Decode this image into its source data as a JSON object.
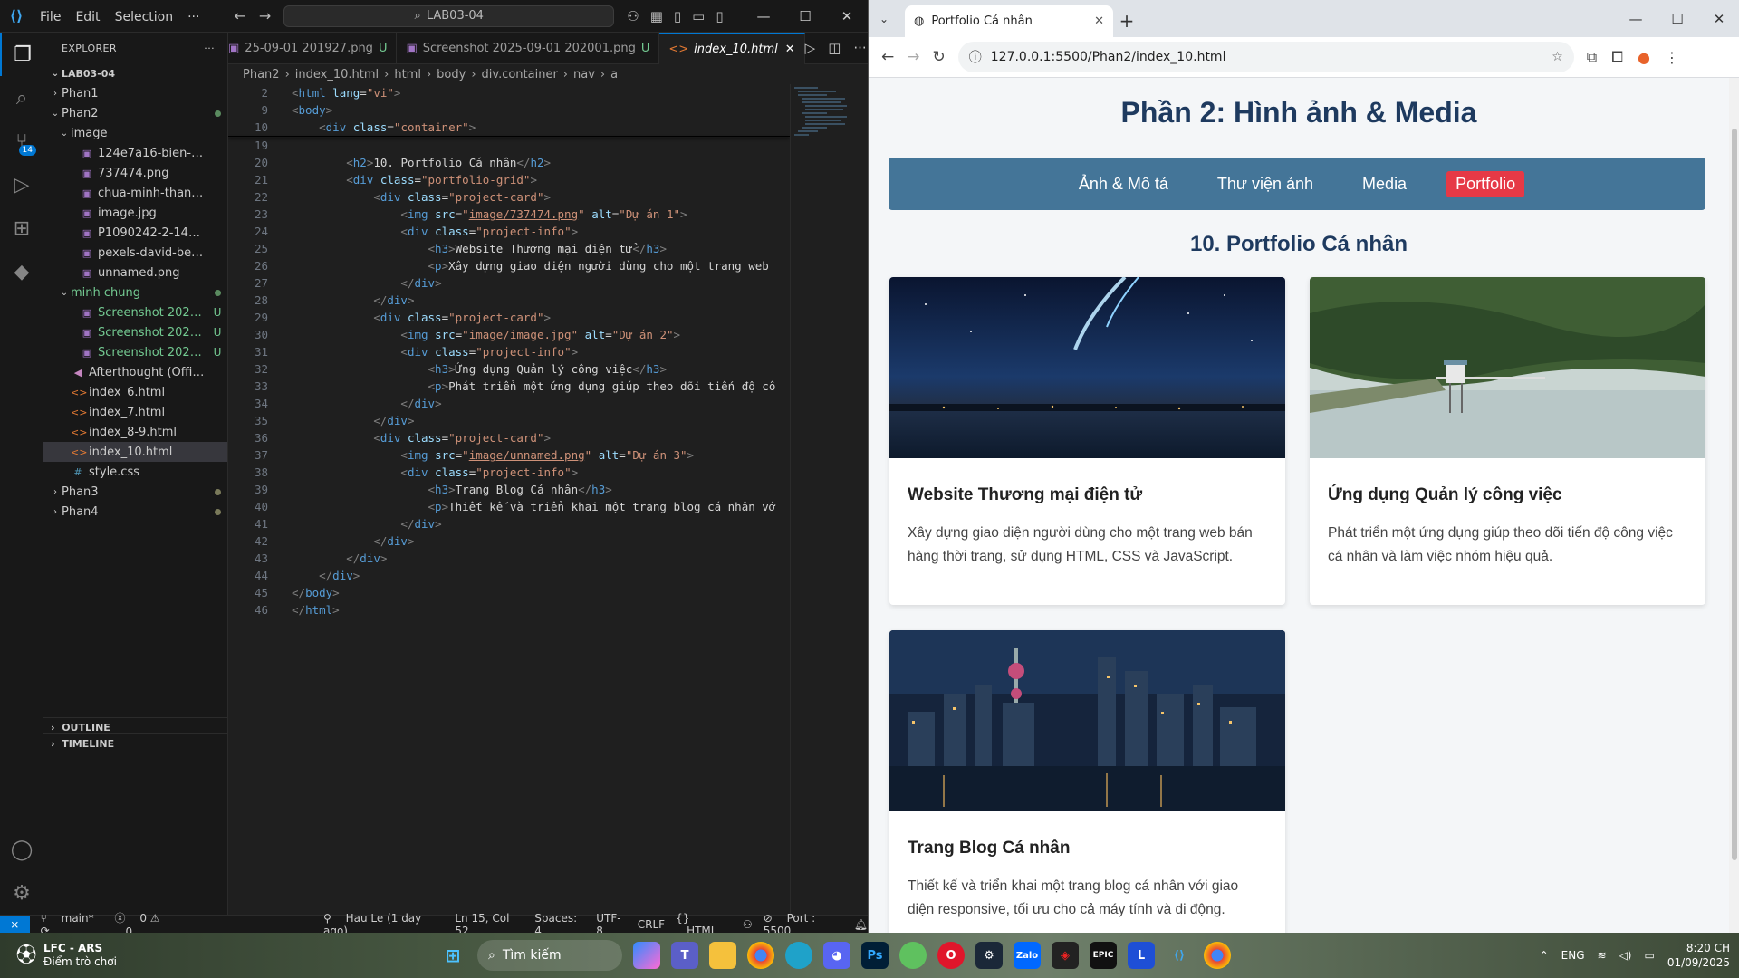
{
  "vscode": {
    "menu": [
      "File",
      "Edit",
      "Selection",
      "···"
    ],
    "command_center": "LAB03-04",
    "explorer_title": "EXPLORER",
    "explorer_more": "···",
    "root": "LAB03-04",
    "tree": [
      {
        "indent": 0,
        "arrow": "›",
        "icon": "",
        "name": "Phan1",
        "status": "",
        "color": "#ccc"
      },
      {
        "indent": 0,
        "arrow": "⌄",
        "icon": "",
        "name": "Phan2",
        "status": "dot",
        "color": "#ccc"
      },
      {
        "indent": 1,
        "arrow": "⌄",
        "icon": "",
        "name": "image",
        "status": "",
        "color": "#ccc"
      },
      {
        "indent": 2,
        "arrow": "",
        "icon": "▣",
        "name": "124e7a16-bien-ho-pleik...",
        "status": "",
        "color": "#ccc"
      },
      {
        "indent": 2,
        "arrow": "",
        "icon": "▣",
        "name": "737474.png",
        "status": "",
        "color": "#ccc"
      },
      {
        "indent": 2,
        "arrow": "",
        "icon": "▣",
        "name": "chua-minh-thanh-pleiku...",
        "status": "",
        "color": "#ccc"
      },
      {
        "indent": 2,
        "arrow": "",
        "icon": "▣",
        "name": "image.jpg",
        "status": "",
        "color": "#ccc"
      },
      {
        "indent": 2,
        "arrow": "",
        "icon": "▣",
        "name": "P1090242-2-1400x788.jpg",
        "status": "",
        "color": "#ccc"
      },
      {
        "indent": 2,
        "arrow": "",
        "icon": "▣",
        "name": "pexels-david-besh-8847...",
        "status": "",
        "color": "#ccc"
      },
      {
        "indent": 2,
        "arrow": "",
        "icon": "▣",
        "name": "unnamed.png",
        "status": "",
        "color": "#ccc"
      },
      {
        "indent": 1,
        "arrow": "⌄",
        "icon": "",
        "name": "minh chung",
        "status": "dot",
        "color": "#73c991"
      },
      {
        "indent": 2,
        "arrow": "",
        "icon": "▣",
        "name": "Screenshot 2025-09...",
        "status": "U",
        "color": "#73c991"
      },
      {
        "indent": 2,
        "arrow": "",
        "icon": "▣",
        "name": "Screenshot 2025-09...",
        "status": "U",
        "color": "#73c991"
      },
      {
        "indent": 2,
        "arrow": "",
        "icon": "▣",
        "name": "Screenshot 2025-09...",
        "status": "U",
        "color": "#73c991"
      },
      {
        "indent": 1,
        "arrow": "",
        "icon": "◀",
        "name": "Afterthought (Official Audi...",
        "status": "",
        "color": "#ccc"
      },
      {
        "indent": 1,
        "arrow": "",
        "icon": "<>",
        "name": "index_6.html",
        "status": "",
        "color": "#ccc"
      },
      {
        "indent": 1,
        "arrow": "",
        "icon": "<>",
        "name": "index_7.html",
        "status": "",
        "color": "#ccc"
      },
      {
        "indent": 1,
        "arrow": "",
        "icon": "<>",
        "name": "index_8-9.html",
        "status": "",
        "color": "#ccc"
      },
      {
        "indent": 1,
        "arrow": "",
        "icon": "<>",
        "name": "index_10.html",
        "status": "",
        "color": "#ccc",
        "selected": true
      },
      {
        "indent": 1,
        "arrow": "",
        "icon": "#",
        "name": "style.css",
        "status": "",
        "color": "#ccc"
      },
      {
        "indent": 0,
        "arrow": "›",
        "icon": "",
        "name": "Phan3",
        "status": "dotg",
        "color": "#ccc"
      },
      {
        "indent": 0,
        "arrow": "›",
        "icon": "",
        "name": "Phan4",
        "status": "dotg",
        "color": "#ccc"
      }
    ],
    "outline": "OUTLINE",
    "timeline": "TIMELINE",
    "tabs": [
      {
        "label": "25-09-01 201927.png",
        "u": "U",
        "active": false
      },
      {
        "label": "Screenshot 2025-09-01 202001.png",
        "u": "U",
        "active": false
      },
      {
        "label": "index_10.html",
        "u": "",
        "active": true
      }
    ],
    "breadcrumb": [
      "Phan2",
      "index_10.html",
      "html",
      "body",
      "div.container",
      "nav",
      "a"
    ],
    "code": [
      {
        "n": "2",
        "h": "<span class='br'>&lt;</span><span class='tg'>html</span> <span class='at'>lang</span><span class='tx'>=</span><span class='sv'>\"vi\"</span><span class='br'>&gt;</span>",
        "stick": true
      },
      {
        "n": "9",
        "h": "<span class='br'>&lt;</span><span class='tg'>body</span><span class='br'>&gt;</span>",
        "stick": true
      },
      {
        "n": "10",
        "h": "    <span class='br'>&lt;</span><span class='tg'>div</span> <span class='at'>class</span><span class='tx'>=</span><span class='sv'>\"container\"</span><span class='br'>&gt;</span>",
        "stick": true
      },
      {
        "n": "19",
        "h": ""
      },
      {
        "n": "20",
        "h": "        <span class='br'>&lt;</span><span class='tg'>h2</span><span class='br'>&gt;</span><span class='tx'>10. Portfolio Cá nhân</span><span class='br'>&lt;/</span><span class='tg'>h2</span><span class='br'>&gt;</span>"
      },
      {
        "n": "21",
        "h": "        <span class='br'>&lt;</span><span class='tg'>div</span> <span class='at'>class</span><span class='tx'>=</span><span class='sv'>\"portfolio-grid\"</span><span class='br'>&gt;</span>"
      },
      {
        "n": "22",
        "h": "            <span class='br'>&lt;</span><span class='tg'>div</span> <span class='at'>class</span><span class='tx'>=</span><span class='sv'>\"project-card\"</span><span class='br'>&gt;</span>"
      },
      {
        "n": "23",
        "h": "                <span class='br'>&lt;</span><span class='tg'>img</span> <span class='at'>src</span><span class='tx'>=</span><span class='sv'>\"<u>image/737474.png</u>\"</span> <span class='at'>alt</span><span class='tx'>=</span><span class='sv'>\"Dự án 1\"</span><span class='br'>&gt;</span>"
      },
      {
        "n": "24",
        "h": "                <span class='br'>&lt;</span><span class='tg'>div</span> <span class='at'>class</span><span class='tx'>=</span><span class='sv'>\"project-info\"</span><span class='br'>&gt;</span>"
      },
      {
        "n": "25",
        "h": "                    <span class='br'>&lt;</span><span class='tg'>h3</span><span class='br'>&gt;</span><span class='tx'>Website Thương mại điện tử</span><span class='br'>&lt;/</span><span class='tg'>h3</span><span class='br'>&gt;</span>"
      },
      {
        "n": "26",
        "h": "                    <span class='br'>&lt;</span><span class='tg'>p</span><span class='br'>&gt;</span><span class='tx'>Xây dựng giao diện người dùng cho một trang web</span>"
      },
      {
        "n": "27",
        "h": "                <span class='br'>&lt;/</span><span class='tg'>div</span><span class='br'>&gt;</span>"
      },
      {
        "n": "28",
        "h": "            <span class='br'>&lt;/</span><span class='tg'>div</span><span class='br'>&gt;</span>"
      },
      {
        "n": "29",
        "h": "            <span class='br'>&lt;</span><span class='tg'>div</span> <span class='at'>class</span><span class='tx'>=</span><span class='sv'>\"project-card\"</span><span class='br'>&gt;</span>"
      },
      {
        "n": "30",
        "h": "                <span class='br'>&lt;</span><span class='tg'>img</span> <span class='at'>src</span><span class='tx'>=</span><span class='sv'>\"<u>image/image.jpg</u>\"</span> <span class='at'>alt</span><span class='tx'>=</span><span class='sv'>\"Dự án 2\"</span><span class='br'>&gt;</span>"
      },
      {
        "n": "31",
        "h": "                <span class='br'>&lt;</span><span class='tg'>div</span> <span class='at'>class</span><span class='tx'>=</span><span class='sv'>\"project-info\"</span><span class='br'>&gt;</span>"
      },
      {
        "n": "32",
        "h": "                    <span class='br'>&lt;</span><span class='tg'>h3</span><span class='br'>&gt;</span><span class='tx'>Ứng dụng Quản lý công việc</span><span class='br'>&lt;/</span><span class='tg'>h3</span><span class='br'>&gt;</span>"
      },
      {
        "n": "33",
        "h": "                    <span class='br'>&lt;</span><span class='tg'>p</span><span class='br'>&gt;</span><span class='tx'>Phát triển một ứng dụng giúp theo dõi tiến độ cô</span>"
      },
      {
        "n": "34",
        "h": "                <span class='br'>&lt;/</span><span class='tg'>div</span><span class='br'>&gt;</span>"
      },
      {
        "n": "35",
        "h": "            <span class='br'>&lt;/</span><span class='tg'>div</span><span class='br'>&gt;</span>"
      },
      {
        "n": "36",
        "h": "            <span class='br'>&lt;</span><span class='tg'>div</span> <span class='at'>class</span><span class='tx'>=</span><span class='sv'>\"project-card\"</span><span class='br'>&gt;</span>"
      },
      {
        "n": "37",
        "h": "                <span class='br'>&lt;</span><span class='tg'>img</span> <span class='at'>src</span><span class='tx'>=</span><span class='sv'>\"<u>image/unnamed.png</u>\"</span> <span class='at'>alt</span><span class='tx'>=</span><span class='sv'>\"Dự án 3\"</span><span class='br'>&gt;</span>"
      },
      {
        "n": "38",
        "h": "                <span class='br'>&lt;</span><span class='tg'>div</span> <span class='at'>class</span><span class='tx'>=</span><span class='sv'>\"project-info\"</span><span class='br'>&gt;</span>"
      },
      {
        "n": "39",
        "h": "                    <span class='br'>&lt;</span><span class='tg'>h3</span><span class='br'>&gt;</span><span class='tx'>Trang Blog Cá nhân</span><span class='br'>&lt;/</span><span class='tg'>h3</span><span class='br'>&gt;</span>"
      },
      {
        "n": "40",
        "h": "                    <span class='br'>&lt;</span><span class='tg'>p</span><span class='br'>&gt;</span><span class='tx'>Thiết kế và triển khai một trang blog cá nhân vớ</span>"
      },
      {
        "n": "41",
        "h": "                <span class='br'>&lt;/</span><span class='tg'>div</span><span class='br'>&gt;</span>"
      },
      {
        "n": "42",
        "h": "            <span class='br'>&lt;/</span><span class='tg'>div</span><span class='br'>&gt;</span>"
      },
      {
        "n": "43",
        "h": "        <span class='br'>&lt;/</span><span class='tg'>div</span><span class='br'>&gt;</span>"
      },
      {
        "n": "44",
        "h": "    <span class='br'>&lt;/</span><span class='tg'>div</span><span class='br'>&gt;</span>"
      },
      {
        "n": "45",
        "h": "<span class='br'>&lt;/</span><span class='tg'>body</span><span class='br'>&gt;</span>"
      },
      {
        "n": "46",
        "h": "<span class='br'>&lt;/</span><span class='tg'>html</span><span class='br'>&gt;</span>"
      }
    ],
    "status": {
      "branch": "main*",
      "errors": "0",
      "warnings": "0",
      "blame": "Hau Le (1 day ago)",
      "pos": "Ln 15, Col 52",
      "spaces": "Spaces: 4",
      "enc": "UTF-8",
      "eol": "CRLF",
      "lang": "HTML",
      "port": "Port : 5500"
    }
  },
  "browser": {
    "tab_title": "Portfolio Cá nhân",
    "url": "127.0.0.1:5500/Phan2/index_10.html",
    "page": {
      "title": "Phần 2: Hình ảnh & Media",
      "nav": [
        {
          "label": "Ảnh & Mô tả",
          "active": false
        },
        {
          "label": "Thư viện ảnh",
          "active": false
        },
        {
          "label": "Media",
          "active": false
        },
        {
          "label": "Portfolio",
          "active": true
        }
      ],
      "section": "10. Portfolio Cá nhân",
      "projects": [
        {
          "title": "Website Thương mại điện tử",
          "desc": "Xây dựng giao diện người dùng cho một trang web bán hàng thời trang, sử dụng HTML, CSS và JavaScript.",
          "image": "night-sky-comet"
        },
        {
          "title": "Ứng dụng Quản lý công việc",
          "desc": "Phát triển một ứng dụng giúp theo dõi tiến độ công việc cá nhân và làm việc nhóm hiệu quả.",
          "image": "lake-pine-forest"
        },
        {
          "title": "Trang Blog Cá nhân",
          "desc": "Thiết kế và triển khai một trang blog cá nhân với giao diện responsive, tối ưu cho cả máy tính và di động.",
          "image": "city-skyline-night"
        }
      ]
    }
  },
  "taskbar": {
    "weather_title": "LFC - ARS",
    "weather_sub": "Điểm trò chơi",
    "search": "Tìm kiếm",
    "lang": "ENG",
    "time": "8:20 CH",
    "date": "01/09/2025"
  },
  "colors": {
    "accent": "#0078d4",
    "nav_bg": "#447598",
    "nav_active": "#e63946",
    "heading": "#1e3a5f"
  }
}
